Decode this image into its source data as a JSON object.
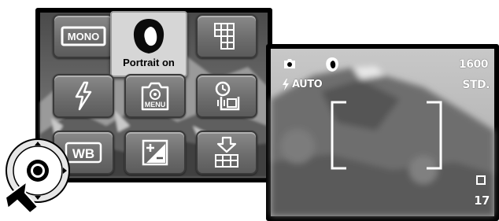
{
  "menu": {
    "portrait_label": "Portrait on",
    "tiles": [
      {
        "name": "mono-button",
        "icon": "mono-icon"
      },
      {
        "name": "portrait-tile",
        "icon": "portrait-icon"
      },
      {
        "name": "grid-button",
        "icon": "grid-icon"
      },
      {
        "name": "flash-button",
        "icon": "flash-icon"
      },
      {
        "name": "menu-button",
        "icon": "camera-menu-icon"
      },
      {
        "name": "self-timer-button",
        "icon": "self-timer-icon"
      },
      {
        "name": "white-balance-button",
        "icon": "wb-icon"
      },
      {
        "name": "exposure-compensation-button",
        "icon": "exposure-compensation-icon"
      },
      {
        "name": "image-size-button",
        "icon": "image-size-icon"
      }
    ],
    "mono_text": "MONO",
    "wb_text": "WB",
    "menu_text": "MENU"
  },
  "viewfinder": {
    "mode_icon": "camera-icon",
    "scene_icon": "portrait-icon",
    "flash_mode": "AUTO",
    "resolution": "1600",
    "quality": "STD.",
    "drive_icon": "single-frame-icon",
    "frames_remaining": "17"
  },
  "colors": {
    "tile_fill": "#6d6d6d",
    "selected_tile_fill": "#d6d6d6",
    "osd_text": "#ffffff"
  }
}
